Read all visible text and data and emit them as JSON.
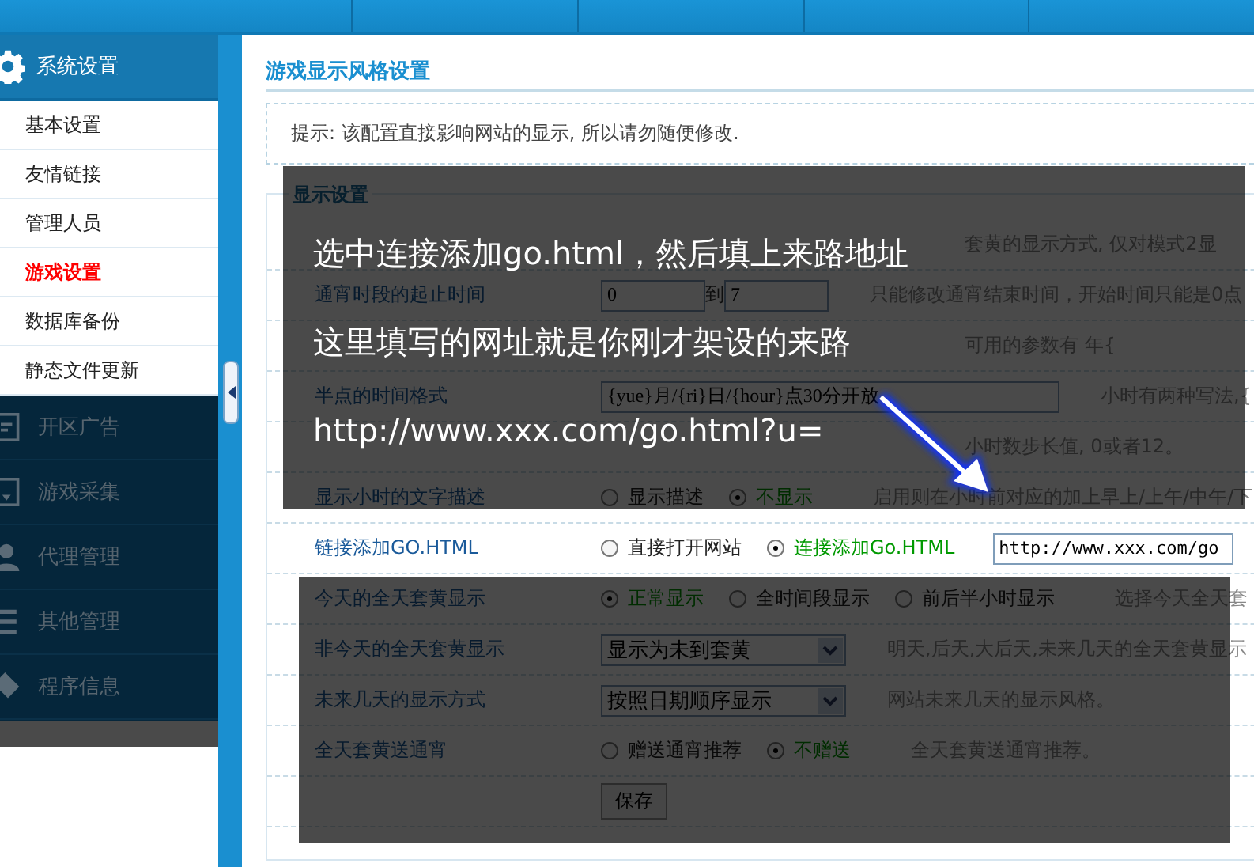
{
  "sidebar": {
    "header": "系统设置",
    "items": [
      {
        "label": "基本设置",
        "selected": false
      },
      {
        "label": "友情链接",
        "selected": false
      },
      {
        "label": "管理人员",
        "selected": false
      },
      {
        "label": "游戏设置",
        "selected": true
      },
      {
        "label": "数据库备份",
        "selected": false
      },
      {
        "label": "静态文件更新",
        "selected": false
      }
    ],
    "sections": [
      {
        "label": "开区广告",
        "kind": "screen"
      },
      {
        "label": "游戏采集",
        "kind": "download"
      },
      {
        "label": "代理管理",
        "kind": "person"
      },
      {
        "label": "其他管理",
        "kind": "list"
      },
      {
        "label": "程序信息",
        "kind": "tag"
      }
    ]
  },
  "page": {
    "title": "游戏显示风格设置",
    "tip": "提示: 该配置直接影响网站的显示, 所以请勿随便修改.",
    "legend": "显示设置",
    "rows": [
      {
        "kind": "covered",
        "desc": "套黄的显示方式, 仅对模式2显"
      },
      {
        "kind": "range",
        "label": "通宵时段的起止时间",
        "from": "0",
        "to_label": "到",
        "to": "7",
        "desc": "只能修改通宵结束时间，开始时间只能是0点"
      },
      {
        "kind": "covered",
        "desc": "可用的参数有 年{"
      },
      {
        "kind": "text",
        "label": "半点的时间格式",
        "value": "{yue}月/{ri}日/{hour}点30分开放",
        "desc": "小时有两种写法,{"
      },
      {
        "kind": "covered",
        "desc": "小时数步长值, 0或者12。"
      },
      {
        "kind": "radio",
        "label": "显示小时的文字描述",
        "options": [
          {
            "label": "显示描述",
            "selected": false
          },
          {
            "label": "不显示",
            "selected": true
          }
        ],
        "desc": "启用则在小时前对应的加上早上/上午/中午/下"
      },
      {
        "kind": "radio",
        "label": "链接添加GO.HTML",
        "options": [
          {
            "label": "直接打开网站",
            "selected": false
          },
          {
            "label": "连接添加Go.HTML",
            "selected": true
          }
        ],
        "value": "http://www.xxx.com/go"
      },
      {
        "kind": "radio",
        "label": "今天的全天套黄显示",
        "options": [
          {
            "label": "正常显示",
            "selected": true
          },
          {
            "label": "全时间段显示",
            "selected": false
          },
          {
            "label": "前后半小时显示",
            "selected": false
          }
        ],
        "desc": "选择今天全天套"
      },
      {
        "kind": "select",
        "label": "非今天的全天套黄显示",
        "value": "显示为未到套黄",
        "desc": "明天,后天,大后天,未来几天的全天套黄显示"
      },
      {
        "kind": "select",
        "label": "未来几天的显示方式",
        "value": "按照日期顺序显示",
        "desc": "网站未来几天的显示风格。"
      },
      {
        "kind": "radio",
        "label": "全天套黄送通宵",
        "options": [
          {
            "label": "赠送通宵推荐",
            "selected": false
          },
          {
            "label": "不赠送",
            "selected": true
          }
        ],
        "desc": "全天套黄送通宵推荐。"
      }
    ],
    "save": "保存"
  },
  "overlay": {
    "captions": [
      "选中连接添加go.html，然后填上来路地址",
      "这里填写的网址就是你刚才架设的来路",
      "http://www.xxx.com/go.html?u="
    ]
  }
}
